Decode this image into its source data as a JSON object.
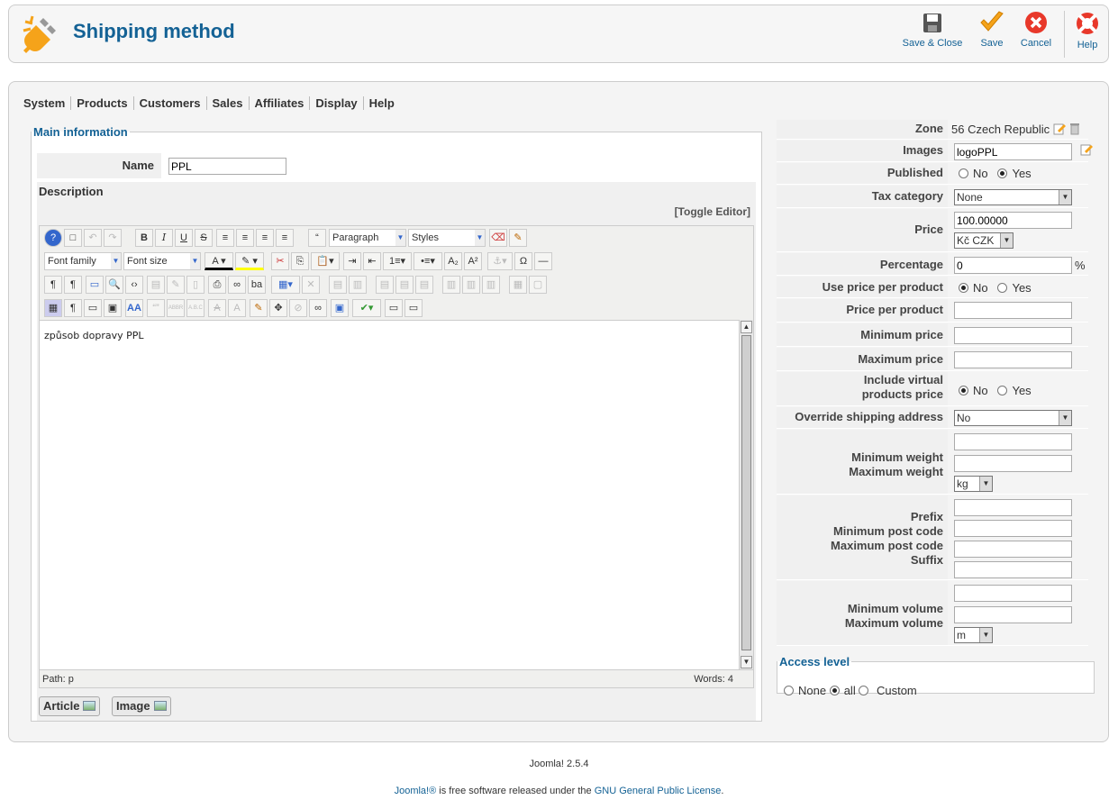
{
  "header": {
    "title": "Shipping method",
    "buttons": [
      {
        "label": "Save & Close",
        "icon": "save-icon"
      },
      {
        "label": "Save",
        "icon": "checkmark-icon"
      },
      {
        "label": "Cancel",
        "icon": "cancel-icon"
      },
      {
        "label": "Help",
        "icon": "lifebuoy-icon"
      }
    ]
  },
  "submenu": [
    "System",
    "Products",
    "Customers",
    "Sales",
    "Affiliates",
    "Display",
    "Help"
  ],
  "main": {
    "legend": "Main information",
    "name_label": "Name",
    "name_value": "PPL",
    "description_label": "Description",
    "toggle_editor": "[Toggle Editor]",
    "editor": {
      "format_select": "Paragraph",
      "styles_select": "Styles",
      "font_family_select": "Font family",
      "font_size_select": "Font size",
      "content": "způsob dopravy PPL",
      "path": "Path:  p",
      "words": "Words: 4"
    },
    "buttons": {
      "article": "Article",
      "image": "Image"
    }
  },
  "right": {
    "zone_label": "Zone",
    "zone_value": "56 Czech Republic",
    "images_label": "Images",
    "images_value": "logoPPL",
    "published_label": "Published",
    "no": "No",
    "yes": "Yes",
    "tax_label": "Tax category",
    "tax_value": "None",
    "price_label": "Price",
    "price_value": "100.00000",
    "currency_value": "Kč CZK",
    "percentage_label": "Percentage",
    "percentage_value": "0",
    "percent_sign": "%",
    "use_price_label": "Use price per product",
    "price_per_product_label": "Price per product",
    "min_price_label": "Minimum price",
    "max_price_label": "Maximum price",
    "include_virtual_label_1": "Include virtual",
    "include_virtual_label_2": "products price",
    "override_label": "Override shipping address",
    "override_value": "No",
    "min_weight_label": "Minimum weight",
    "max_weight_label": "Maximum weight",
    "weight_unit": "kg",
    "prefix_label": "Prefix",
    "min_post_label": "Minimum post code",
    "max_post_label": "Maximum post code",
    "suffix_label": "Suffix",
    "min_volume_label": "Minimum volume",
    "max_volume_label": "Maximum volume",
    "volume_unit": "m"
  },
  "access": {
    "legend": "Access level",
    "none": "None",
    "all": "all",
    "custom": "Custom"
  },
  "footer": {
    "version": "Joomla! 2.5.4",
    "link1": "Joomla!®",
    "text": " is free software released under the ",
    "link2": "GNU General Public License",
    "end": "."
  }
}
